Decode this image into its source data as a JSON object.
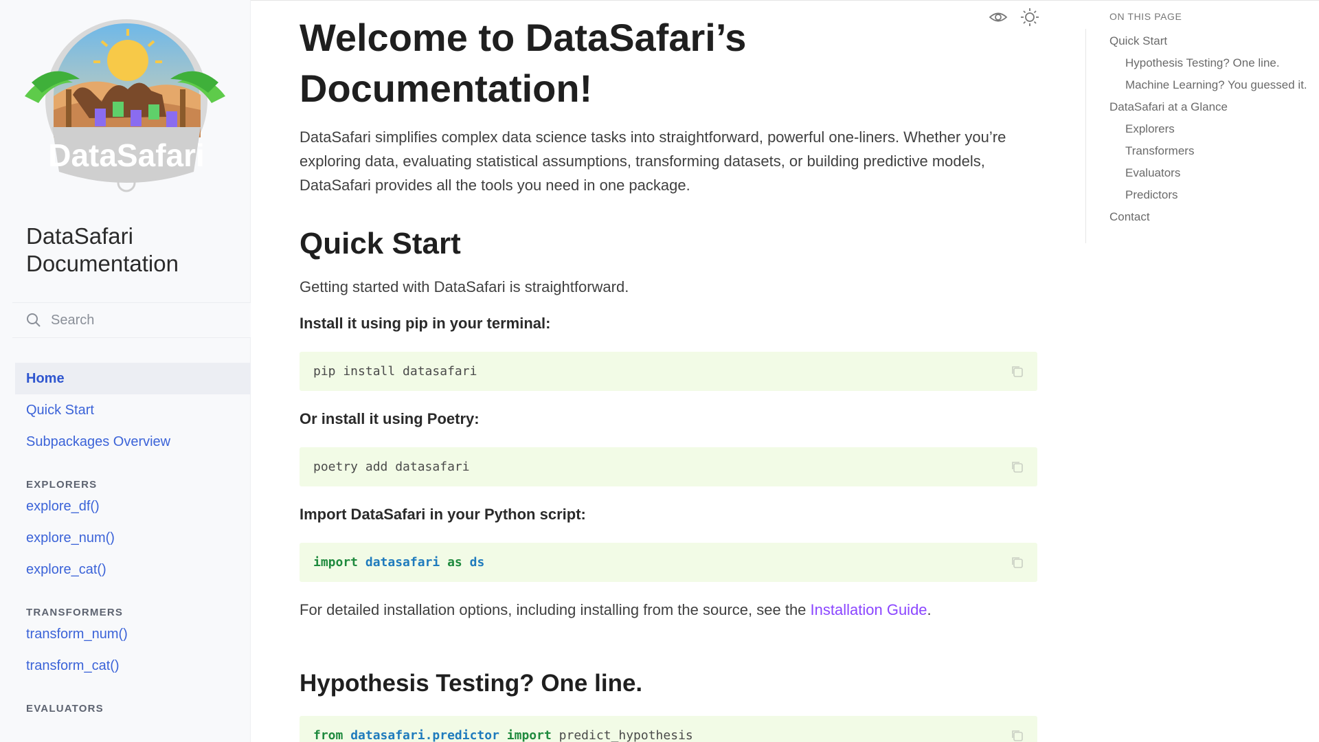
{
  "sidebar": {
    "logo_text": "DataSafari",
    "title": "DataSafari Documentation",
    "search_placeholder": "Search",
    "nav": [
      {
        "label": "Home",
        "active": true
      },
      {
        "label": "Quick Start"
      },
      {
        "label": "Subpackages Overview"
      }
    ],
    "sections": [
      {
        "title": "EXPLORERS",
        "items": [
          "explore_df()",
          "explore_num()",
          "explore_cat()"
        ]
      },
      {
        "title": "TRANSFORMERS",
        "items": [
          "transform_num()",
          "transform_cat()"
        ]
      },
      {
        "title": "EVALUATORS",
        "items": []
      }
    ]
  },
  "main": {
    "title": "Welcome to DataSafari’s Documentation!",
    "intro": "DataSafari simplifies complex data science tasks into straightforward, powerful one-liners. Whether you’re exploring data, evaluating statistical assumptions, transforming datasets, or building predictive models, DataSafari provides all the tools you need in one package.",
    "quick_start": {
      "heading": "Quick Start",
      "lead": "Getting started with DataSafari is straightforward.",
      "pip_label": "Install it using pip in your terminal:",
      "pip_cmd": "pip install datasafari",
      "poetry_label": "Or install it using Poetry:",
      "poetry_cmd": "poetry add datasafari",
      "import_label": "Import DataSafari in your Python script:",
      "import_kw1": "import",
      "import_mod": "datasafari",
      "import_kw2": "as",
      "import_alias": "ds",
      "details_prefix": "For detailed installation options, including installing from the source, see the",
      "details_link": "Installation Guide",
      "details_suffix": "."
    },
    "hypothesis": {
      "heading": "Hypothesis Testing? One line.",
      "code_kw1": "from",
      "code_mod": "datasafari.predictor",
      "code_kw2": "import",
      "code_name": "predict_hypothesis"
    }
  },
  "toc": {
    "title": "ON THIS PAGE",
    "items": [
      {
        "label": "Quick Start",
        "level": 1
      },
      {
        "label": "Hypothesis Testing? One line.",
        "level": 2
      },
      {
        "label": "Machine Learning? You guessed it.",
        "level": 2
      },
      {
        "label": "DataSafari at a Glance",
        "level": 1
      },
      {
        "label": "Explorers",
        "level": 2
      },
      {
        "label": "Transformers",
        "level": 2
      },
      {
        "label": "Evaluators",
        "level": 2
      },
      {
        "label": "Predictors",
        "level": 2
      },
      {
        "label": "Contact",
        "level": 1
      }
    ]
  },
  "icons": {
    "search": "search-icon",
    "copy": "copy-icon",
    "view_source": "eye-icon",
    "theme": "sun-icon"
  },
  "colors": {
    "link": "#3b63d8",
    "accent_link": "#8b46ff",
    "code_bg": "#f2fbe6",
    "keyword": "#1f8a3e",
    "module": "#1f7bbd"
  }
}
